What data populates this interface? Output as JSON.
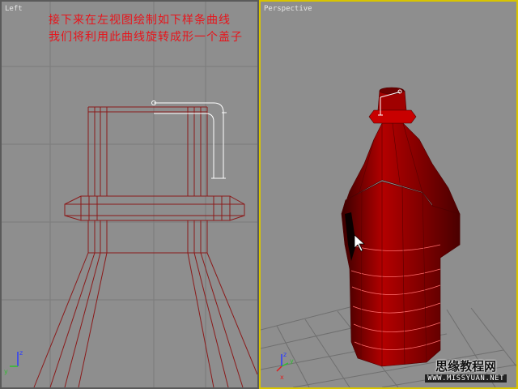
{
  "viewports": {
    "left": {
      "label": "Left"
    },
    "perspective": {
      "label": "Perspective"
    }
  },
  "annotation": {
    "line1": "接下来在左视图绘制如下样条曲线",
    "line2": "我们将利用此曲线旋转成形一个盖子"
  },
  "axis_labels": {
    "x": "x",
    "y": "y",
    "z": "z"
  },
  "watermark": {
    "title": "思缘教程网",
    "url": "WWW.MISSYUAN.NET"
  },
  "colors": {
    "wireframe": "#8b1a1a",
    "spline": "#ffffff",
    "bottle_red": "#8c0000",
    "active_border": "#d8c400",
    "annotation_text": "#e8141b"
  }
}
